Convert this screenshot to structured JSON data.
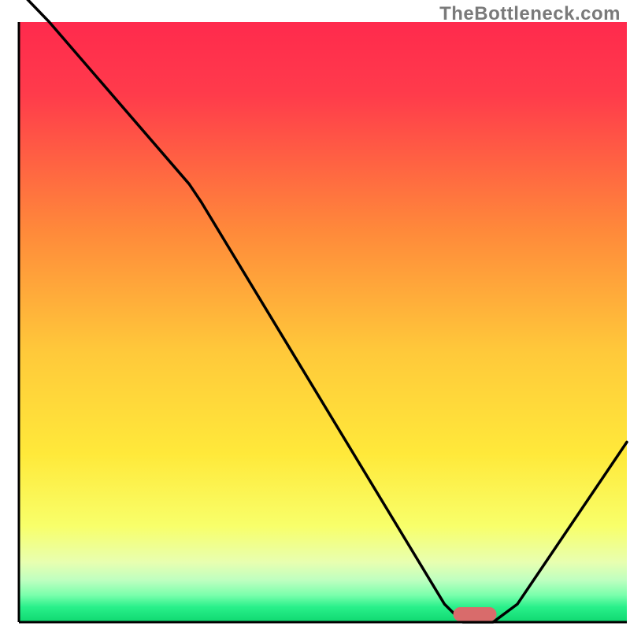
{
  "attribution": "TheBottleneck.com",
  "chart_data": {
    "type": "line",
    "title": "",
    "xlabel": "",
    "ylabel": "",
    "xlim": [
      0,
      100
    ],
    "ylim": [
      0,
      100
    ],
    "x": [
      0,
      5,
      28,
      30,
      70,
      73,
      78,
      82,
      100
    ],
    "values": [
      120,
      100,
      73,
      70,
      3,
      0,
      0,
      3,
      30
    ],
    "notes": "Bottleneck-style curve: high on the left, sharp descent, flat minimum near x≈73–78, rising toward the right. Background is a vertical gradient red→orange→yellow→green representing bottleneck severity; a small red pill marker sits at the curve minimum on the green band.",
    "optimal_marker_x": 75,
    "gradient_stops": [
      {
        "offset": 0.0,
        "color": "#ff2a4d"
      },
      {
        "offset": 0.12,
        "color": "#ff3b4b"
      },
      {
        "offset": 0.35,
        "color": "#ff8a3a"
      },
      {
        "offset": 0.55,
        "color": "#ffc93a"
      },
      {
        "offset": 0.72,
        "color": "#ffe93a"
      },
      {
        "offset": 0.84,
        "color": "#f8ff6a"
      },
      {
        "offset": 0.9,
        "color": "#e8ffb0"
      },
      {
        "offset": 0.93,
        "color": "#bfffc0"
      },
      {
        "offset": 0.955,
        "color": "#7affac"
      },
      {
        "offset": 0.975,
        "color": "#29f08a"
      },
      {
        "offset": 1.0,
        "color": "#0fd870"
      }
    ]
  }
}
